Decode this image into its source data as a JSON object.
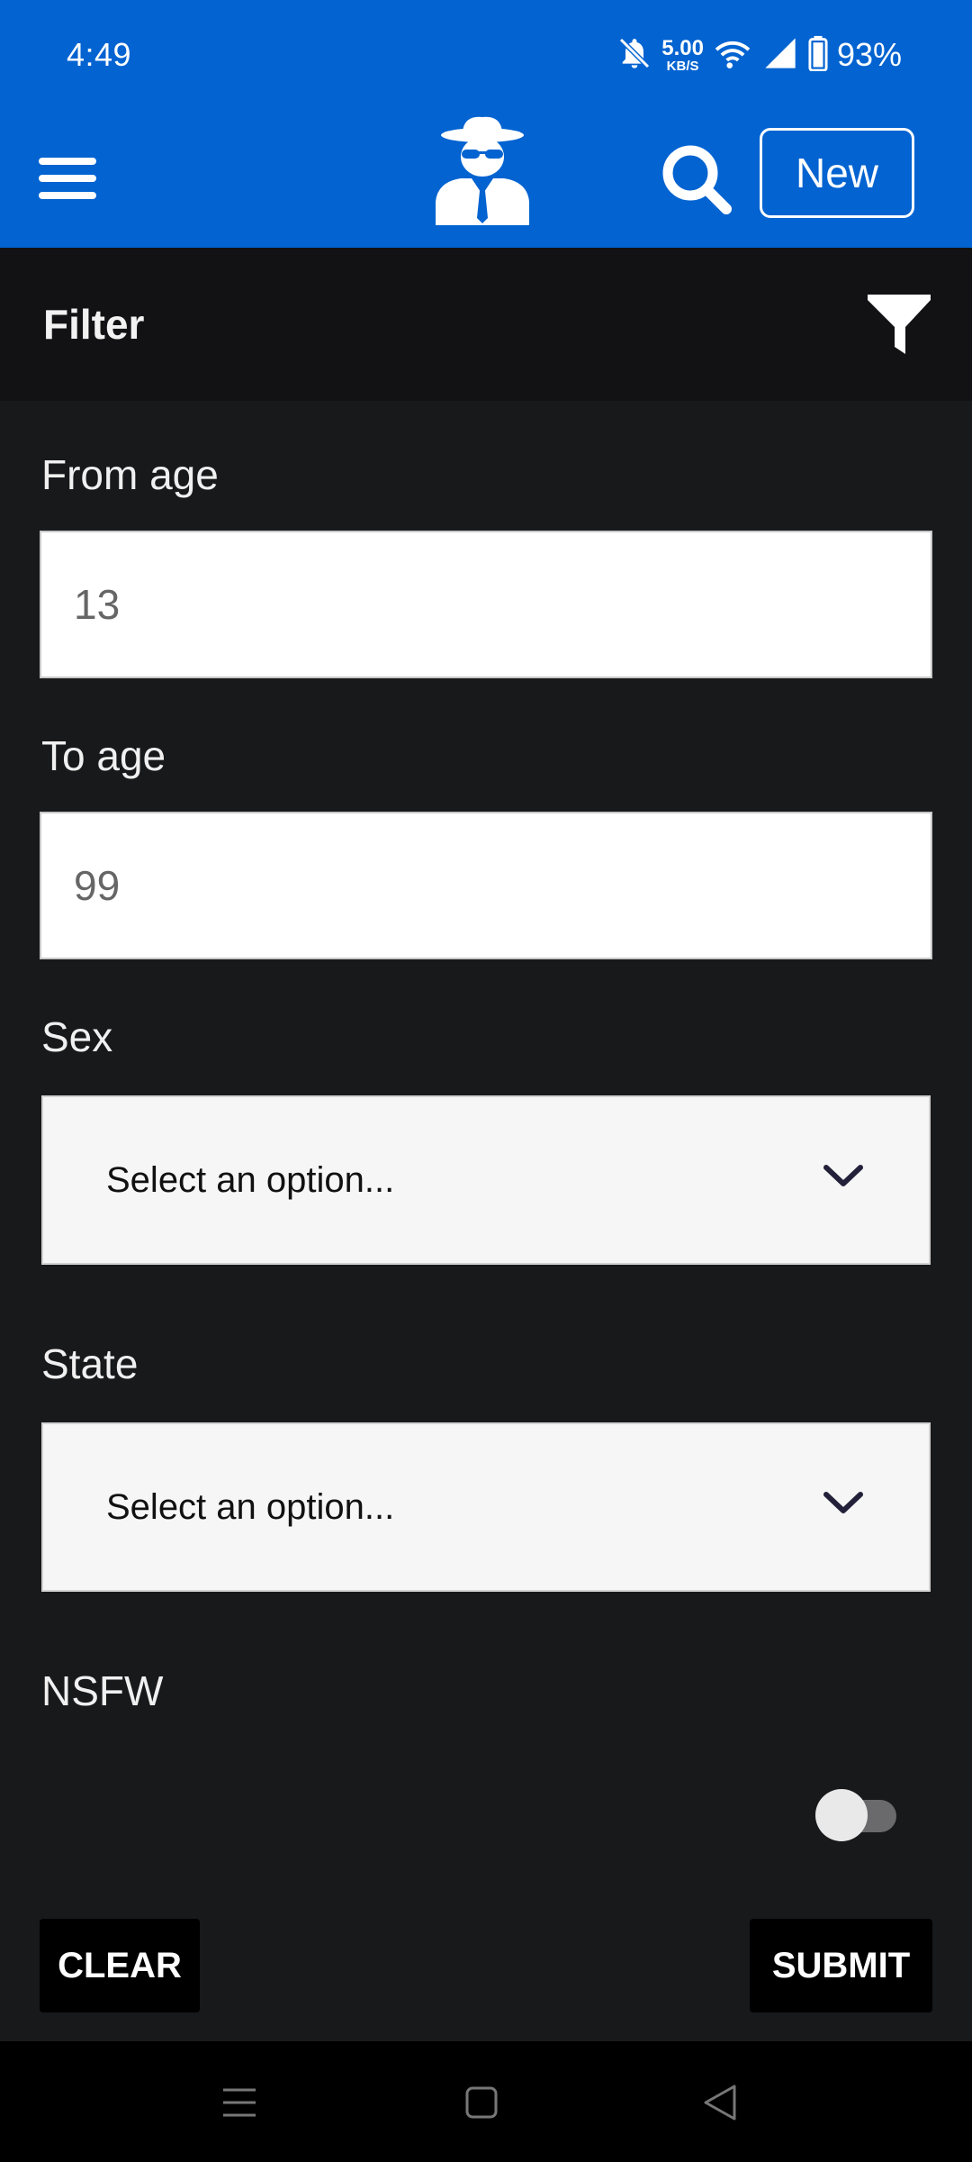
{
  "status_bar": {
    "time": "4:49",
    "net_speed_value": "5.00",
    "net_speed_unit": "KB/S",
    "battery_percent": "93%"
  },
  "app_bar": {
    "menu_icon": "hamburger-menu-icon",
    "logo_icon": "spy-agent-icon",
    "search_icon": "search-icon",
    "new_button_label": "New",
    "background_color": "#0263d1"
  },
  "filter": {
    "title": "Filter",
    "icon": "funnel-icon"
  },
  "form": {
    "from_age": {
      "label": "From age",
      "value": "13"
    },
    "to_age": {
      "label": "To age",
      "value": "99"
    },
    "sex": {
      "label": "Sex",
      "selected": "Select an option..."
    },
    "state": {
      "label": "State",
      "selected": "Select an option..."
    },
    "nsfw": {
      "label": "NSFW",
      "enabled": false
    }
  },
  "actions": {
    "clear_label": "CLEAR",
    "submit_label": "SUBMIT"
  },
  "nav_bar": {
    "items": [
      "recents-menu-icon",
      "home-square-icon",
      "back-triangle-icon"
    ]
  }
}
